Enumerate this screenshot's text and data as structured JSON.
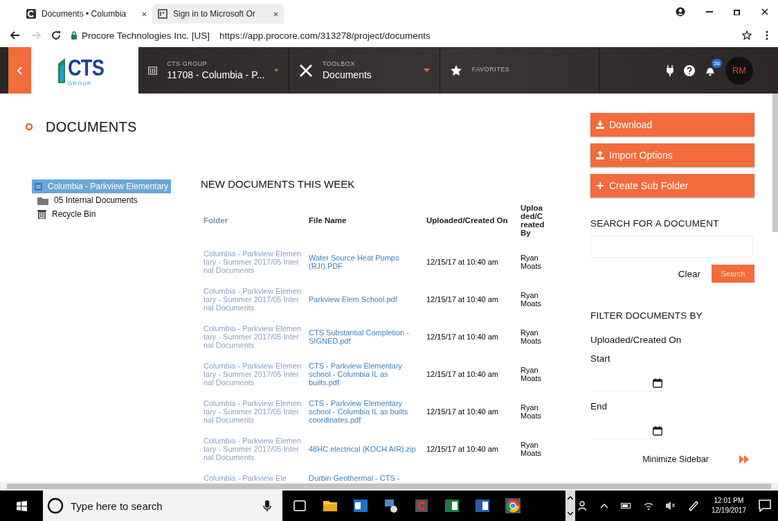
{
  "browser": {
    "tabs": [
      {
        "title": "Documents • Columbia",
        "close": "×",
        "selected": true
      },
      {
        "title": "Sign in to Microsoft Or",
        "close": "×",
        "selected": false
      }
    ],
    "site_identity": "Procore Technologies Inc. [US]",
    "url": "https://app.procore.com/313278/project/documents"
  },
  "navbar": {
    "logo_text": "CTS",
    "logo_subtext": "GROUP",
    "project_label": "CTS GROUP",
    "project_value": "11708 - Columbia - P...",
    "tool_label": "TOOLBOX",
    "tool_value": "Documents",
    "favorites_label": "FAVORITES",
    "notification_badge": "36",
    "avatar": "RM"
  },
  "page_title": "DOCUMENTS",
  "tree": [
    {
      "label": "Columbia - Parkview Elementary",
      "kind": "project",
      "selected": true,
      "children": [
        {
          "label": "05 Internal Documents",
          "kind": "folder",
          "selected": false
        },
        {
          "label": "Recycle Bin",
          "kind": "trash",
          "selected": false
        }
      ]
    }
  ],
  "table": {
    "title": "NEW DOCUMENTS THIS WEEK",
    "columns": [
      "Folder",
      "File Name",
      "Uploaded/Created On",
      "Uploaded/Created By"
    ],
    "rows": [
      {
        "folder": "Columbia - Parkview Elementary - Summer 2017/05 Internal Documents",
        "file": "Water Source Heat Pumps (RJI).PDF",
        "date": "12/15/17 at 10:40 am",
        "by": "Ryan Moats"
      },
      {
        "folder": "Columbia - Parkview Elementary - Summer 2017/05 Internal Documents",
        "file": "Parkview Elem School.pdf",
        "date": "12/15/17 at 10:40 am",
        "by": "Ryan Moats"
      },
      {
        "folder": "Columbia - Parkview Elementary - Summer 2017/05 Internal Documents",
        "file": "CTS Substantial Completion - SIGNED.pdf",
        "date": "12/15/17 at 10:40 am",
        "by": "Ryan Moats"
      },
      {
        "folder": "Columbia - Parkview Elementary - Summer 2017/05 Internal Documents",
        "file": "CTS - Parkview Elementary school - Columbia IL as builts.pdf",
        "date": "12/15/17 at 10:40 am",
        "by": "Ryan Moats"
      },
      {
        "folder": "Columbia - Parkview Elementary - Summer 2017/05 Internal Documents",
        "file": "CTS - Parkview Elementary school - Columbia IL as builts coordinates.pdf",
        "date": "12/15/17 at 10:40 am",
        "by": "Ryan Moats"
      },
      {
        "folder": "Columbia - Parkview Elementary - Summer 2017/05 Internal Documents",
        "file": "48HC electrical (KOCH AIR).zip",
        "date": "12/15/17 at 10:40 am",
        "by": "Ryan Moats"
      },
      {
        "folder": "Columbia - Parkview Ele",
        "file": "Durbin Geothermal - CTS -"
      }
    ]
  },
  "sidebar": {
    "actions": [
      {
        "label": "Download",
        "kind": "download"
      },
      {
        "label": "Import Options",
        "kind": "import"
      },
      {
        "label": "Create Sub Folder",
        "kind": "add"
      }
    ],
    "search_heading": "SEARCH FOR A DOCUMENT",
    "clear_label": "Clear",
    "search_label": "Search",
    "filter_heading": "FILTER DOCUMENTS BY",
    "filter_field": "Uploaded/Created On",
    "start_label": "Start",
    "end_label": "End",
    "minimize_label": "Minimize Sidebar"
  },
  "taskbar": {
    "search_placeholder": "Type here to search",
    "time": "12:01 PM",
    "date": "12/19/2017"
  }
}
